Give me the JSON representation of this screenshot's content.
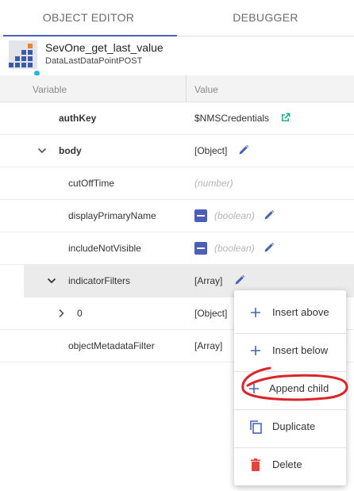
{
  "tabs": [
    {
      "label": "OBJECT EDITOR",
      "active": true
    },
    {
      "label": "DEBUGGER",
      "active": false
    }
  ],
  "object": {
    "name": "SevOne_get_last_value",
    "type": "DataLastDataPointPOST",
    "icon": "stacked-blocks-icon"
  },
  "grid": {
    "headers": {
      "variable": "Variable",
      "value": "Value"
    },
    "rows": [
      {
        "name": "authKey",
        "value": "$NMSCredentials"
      },
      {
        "name": "body",
        "value": "[Object]"
      },
      {
        "name": "cutOffTime",
        "value": "(number)"
      },
      {
        "name": "displayPrimaryName",
        "value": "(boolean)"
      },
      {
        "name": "includeNotVisible",
        "value": "(boolean)"
      },
      {
        "name": "indicatorFilters",
        "value": "[Array]"
      },
      {
        "name": "0",
        "value": "[Object]"
      },
      {
        "name": "objectMetadataFilter",
        "value": "[Array]"
      }
    ]
  },
  "menu": {
    "items": [
      {
        "label": "Insert above",
        "icon": "plus-icon"
      },
      {
        "label": "Insert below",
        "icon": "plus-icon"
      },
      {
        "label": "Append child",
        "icon": "plus-icon"
      },
      {
        "label": "Duplicate",
        "icon": "copy-icon"
      },
      {
        "label": "Delete",
        "icon": "trash-icon"
      }
    ]
  },
  "colors": {
    "accent": "#4a63b5",
    "link_icon": "#1fae8e",
    "delete_icon": "#e0443e",
    "annotation": "#d9262b",
    "status_dot": "#2bb3e6"
  }
}
